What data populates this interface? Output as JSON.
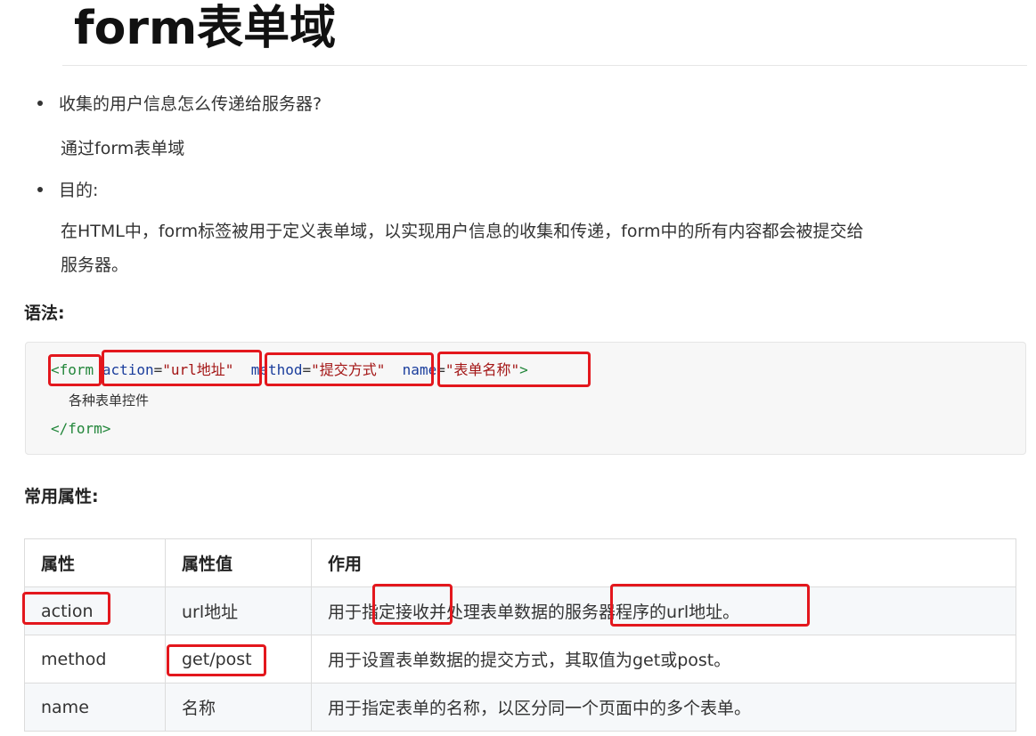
{
  "title": "form表单域",
  "bullets": [
    {
      "text": "收集的用户信息怎么传递给服务器?",
      "answer": "通过form表单域"
    },
    {
      "text": "目的:",
      "answer_line1": "在HTML中，form标签被用于定义表单域，以实现用户信息的收集和传递，form中的所有内容都会被提交给",
      "answer_line2": "服务器。"
    }
  ],
  "syntax_heading": "语法:",
  "code": {
    "open_tag": "<form",
    "action_attr": "action",
    "action_val": "\"url地址\"",
    "method_attr": "method",
    "method_val": "\"提交方式\"",
    "name_attr": "name",
    "name_val": "\"表单名称\"",
    "close_bracket": ">",
    "body": "各种表单控件",
    "close_tag": "</form>",
    "eq": "="
  },
  "props_heading": "常用属性:",
  "table": {
    "headers": [
      "属性",
      "属性值",
      "作用"
    ],
    "rows": [
      {
        "attr": "action",
        "value": "url地址",
        "desc_a": "用于",
        "desc_b": "指定接收",
        "desc_c": "并处理表单数据的",
        "desc_d": "服务器程序的url地址。"
      },
      {
        "attr": "method",
        "value": "get/post",
        "desc": "用于设置表单数据的提交方式，其取值为get或post。"
      },
      {
        "attr": "name",
        "value": "名称",
        "desc": "用于指定表单的名称，以区分同一个页面中的多个表单。"
      }
    ]
  },
  "colors": {
    "highlight_box": "#e3171d",
    "code_bg": "#f7f7f7"
  }
}
